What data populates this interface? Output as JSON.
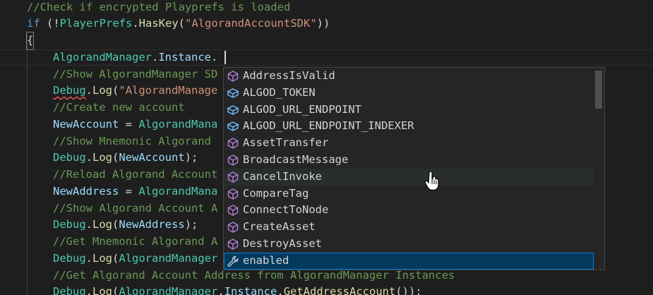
{
  "editor": {
    "lines": [
      {
        "id": "l1",
        "segments": [
          {
            "c": "c-comment",
            "t": "//Check if encrypted Playprefs is loaded"
          }
        ]
      },
      {
        "id": "l2",
        "segments": [
          {
            "c": "c-kw",
            "t": "if"
          },
          {
            "c": "c-plain",
            "t": " (!"
          },
          {
            "c": "c-type",
            "t": "PlayerPrefs"
          },
          {
            "c": "c-plain",
            "t": "."
          },
          {
            "c": "c-fn",
            "t": "HasKey"
          },
          {
            "c": "c-plain",
            "t": "("
          },
          {
            "c": "c-str",
            "t": "\"AlgorandAccountSDK\""
          },
          {
            "c": "c-plain",
            "t": "))"
          }
        ]
      },
      {
        "id": "l3",
        "segments": [
          {
            "c": "c-plain",
            "t": "{"
          }
        ]
      },
      {
        "id": "l4",
        "segments": [
          {
            "c": "c-type",
            "t": "AlgorandManager"
          },
          {
            "c": "c-plain",
            "t": "."
          },
          {
            "c": "c-var",
            "t": "Instance"
          },
          {
            "c": "c-plain",
            "t": "."
          }
        ]
      },
      {
        "id": "l5",
        "segments": [
          {
            "c": "c-comment",
            "t": "//Show AlgorandManager SD"
          }
        ]
      },
      {
        "id": "l6",
        "segments": [
          {
            "c": "c-type",
            "t": "Debug"
          },
          {
            "c": "c-plain",
            "t": "."
          },
          {
            "c": "c-fn",
            "t": "Log"
          },
          {
            "c": "c-plain",
            "t": "("
          },
          {
            "c": "c-str",
            "t": "\"AlgorandManage"
          }
        ]
      },
      {
        "id": "l7",
        "segments": [
          {
            "c": "c-comment",
            "t": "//Create new account"
          }
        ]
      },
      {
        "id": "l8",
        "segments": [
          {
            "c": "c-var",
            "t": "NewAccount"
          },
          {
            "c": "c-plain",
            "t": " = "
          },
          {
            "c": "c-type",
            "t": "AlgorandMana"
          }
        ]
      },
      {
        "id": "l9",
        "segments": [
          {
            "c": "c-comment",
            "t": "//Show Mnemonic Algorand"
          }
        ]
      },
      {
        "id": "l10",
        "segments": [
          {
            "c": "c-type",
            "t": "Debug"
          },
          {
            "c": "c-plain",
            "t": "."
          },
          {
            "c": "c-fn",
            "t": "Log"
          },
          {
            "c": "c-plain",
            "t": "("
          },
          {
            "c": "c-var",
            "t": "NewAccount"
          },
          {
            "c": "c-plain",
            "t": ");"
          }
        ]
      },
      {
        "id": "l11",
        "segments": [
          {
            "c": "c-comment",
            "t": "//Reload Algorand Account"
          }
        ]
      },
      {
        "id": "l12",
        "segments": [
          {
            "c": "c-var",
            "t": "NewAddress"
          },
          {
            "c": "c-plain",
            "t": " = "
          },
          {
            "c": "c-type",
            "t": "AlgorandMana"
          }
        ]
      },
      {
        "id": "l13",
        "segments": [
          {
            "c": "c-comment",
            "t": "//Show Algorand Account A"
          }
        ]
      },
      {
        "id": "l14",
        "segments": [
          {
            "c": "c-type",
            "t": "Debug"
          },
          {
            "c": "c-plain",
            "t": "."
          },
          {
            "c": "c-fn",
            "t": "Log"
          },
          {
            "c": "c-plain",
            "t": "("
          },
          {
            "c": "c-var",
            "t": "NewAddress"
          },
          {
            "c": "c-plain",
            "t": ");"
          }
        ]
      },
      {
        "id": "l15",
        "segments": [
          {
            "c": "c-comment",
            "t": "//Get Mnemonic Algorand A"
          }
        ]
      },
      {
        "id": "l16",
        "segments": [
          {
            "c": "c-type",
            "t": "Debug"
          },
          {
            "c": "c-plain",
            "t": "."
          },
          {
            "c": "c-fn",
            "t": "Log"
          },
          {
            "c": "c-plain",
            "t": "("
          },
          {
            "c": "c-type",
            "t": "AlgorandManager"
          }
        ]
      },
      {
        "id": "l17",
        "segments": [
          {
            "c": "c-comment",
            "t": "//Get Algorand Account Address from AlgorandManager Instances"
          }
        ]
      },
      {
        "id": "l18",
        "segments": [
          {
            "c": "c-type",
            "t": "Debug"
          },
          {
            "c": "c-plain",
            "t": "."
          },
          {
            "c": "c-fn",
            "t": "Log"
          },
          {
            "c": "c-plain",
            "t": "("
          },
          {
            "c": "c-type",
            "t": "AlgorandManager"
          },
          {
            "c": "c-plain",
            "t": "."
          },
          {
            "c": "c-var",
            "t": "Instance"
          },
          {
            "c": "c-plain",
            "t": "."
          },
          {
            "c": "c-fn",
            "t": "GetAddressAccount"
          },
          {
            "c": "c-plain",
            "t": "());"
          }
        ]
      }
    ]
  },
  "suggest": {
    "items": [
      {
        "label": "AddressIsValid",
        "icon": "method-cube-icon"
      },
      {
        "label": "ALGOD_TOKEN",
        "icon": "field-icon"
      },
      {
        "label": "ALGOD_URL_ENDPOINT",
        "icon": "field-icon"
      },
      {
        "label": "ALGOD_URL_ENDPOINT_INDEXER",
        "icon": "field-icon"
      },
      {
        "label": "AssetTransfer",
        "icon": "method-cube-icon"
      },
      {
        "label": "BroadcastMessage",
        "icon": "method-cube-icon"
      },
      {
        "label": "CancelInvoke",
        "icon": "method-cube-icon"
      },
      {
        "label": "CompareTag",
        "icon": "method-cube-icon"
      },
      {
        "label": "ConnectToNode",
        "icon": "method-cube-icon"
      },
      {
        "label": "CreateAsset",
        "icon": "method-cube-icon"
      },
      {
        "label": "DestroyAsset",
        "icon": "method-cube-icon"
      },
      {
        "label": "enabled",
        "icon": "wrench-property-icon"
      }
    ]
  },
  "colors": {
    "background": "#1e1e1e",
    "comment": "#6a9955",
    "keyword": "#569cd6",
    "type": "#4ec9b0",
    "function": "#dcdcaa",
    "string": "#ce9178",
    "variable": "#9cdcfe",
    "method_icon": "#b180d7",
    "field_icon": "#75beff",
    "selected_bg": "#04395e"
  }
}
